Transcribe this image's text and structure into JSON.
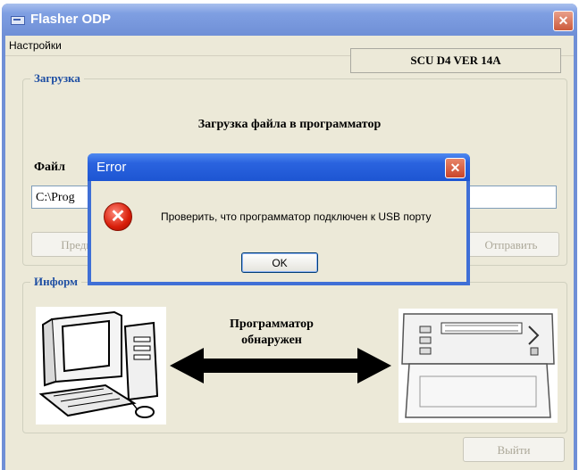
{
  "window": {
    "title": "Flasher ODP",
    "close_glyph": "✕"
  },
  "menu": {
    "items": [
      "Настройки"
    ]
  },
  "load_group": {
    "label": "Загрузка",
    "version": "SCU D4 VER  14A",
    "heading": "Загрузка файла в программатор",
    "file_label": "Файл",
    "file_path": "C:\\Prog",
    "preview_button": "Предыд",
    "send_button": "Отправить"
  },
  "info_group": {
    "label": "Информ",
    "status_line1": "Программатор",
    "status_line2": "обнаружен"
  },
  "exit_button": "Выйти",
  "dialog": {
    "title": "Error",
    "close_glyph": "✕",
    "icon": "error-icon",
    "message": "Проверить, что программатор подключен к USB порту",
    "ok_label": "OK"
  },
  "colors": {
    "accent": "#1f4fa3",
    "titlebar": "#6f8fd6",
    "dialog_titlebar": "#2a63df",
    "error": "#d81e0a"
  }
}
